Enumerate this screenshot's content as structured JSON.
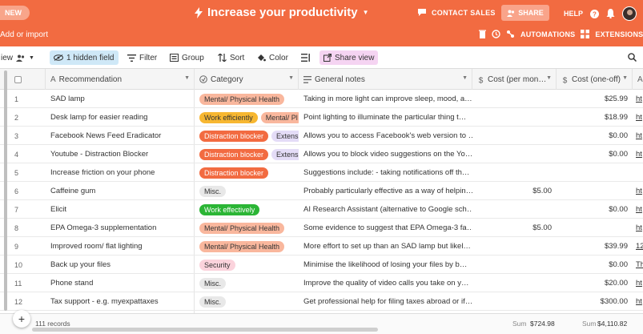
{
  "topbar": {
    "new_label": "NEW",
    "title": "Increase your productivity",
    "contact_label": "CONTACT SALES",
    "share_label": "SHARE",
    "help_label": "HELP",
    "add_import_label": "Add or import",
    "automations_label": "AUTOMATIONS",
    "extensions_label": "EXTENSIONS",
    "accent_color": "#f26b41"
  },
  "toolbar": {
    "view_label": "iew",
    "hidden_label": "1 hidden field",
    "filter_label": "Filter",
    "group_label": "Group",
    "sort_label": "Sort",
    "color_label": "Color",
    "share_view_label": "Share view"
  },
  "columns": {
    "recommendation": "Recommendation",
    "category": "Category",
    "notes": "General notes",
    "cost_per": "Cost (per mon…",
    "cost_one": "Cost (one-off)"
  },
  "rows": [
    {
      "num": "1",
      "rec": "SAD lamp",
      "tags": [
        {
          "label": "Mental/ Physical Health",
          "color": "#f9b79d"
        }
      ],
      "notes": "Taking in more light can improve sleep, mood, a…",
      "per": "",
      "one": "$25.99",
      "link": "ht"
    },
    {
      "num": "2",
      "rec": "Desk lamp for easier reading",
      "tags": [
        {
          "label": "Work efficiently",
          "color": "#f7b731"
        },
        {
          "label": "Mental/ Pl",
          "color": "#f9b79d"
        }
      ],
      "notes": "Point lighting to illuminate the particular thing t…",
      "per": "",
      "one": "$18.99",
      "link": "ht"
    },
    {
      "num": "3",
      "rec": "Facebook News Feed Eradicator",
      "tags": [
        {
          "label": "Distraction blocker",
          "color": "#f26b41"
        },
        {
          "label": "Extensi",
          "color": "#e4dcf7"
        }
      ],
      "notes": "Allows you to access Facebook's web version to …",
      "per": "",
      "one": "$0.00",
      "link": "ht"
    },
    {
      "num": "4",
      "rec": "Youtube - Distraction Blocker",
      "tags": [
        {
          "label": "Distraction blocker",
          "color": "#f26b41"
        },
        {
          "label": "Extensi",
          "color": "#e4dcf7"
        }
      ],
      "notes": "Allows you to block video suggestions on the Yo…",
      "per": "",
      "one": "$0.00",
      "link": "ht"
    },
    {
      "num": "5",
      "rec": "Increase friction on your phone",
      "tags": [
        {
          "label": "Distraction blocker",
          "color": "#f26b41"
        }
      ],
      "notes": "Suggestions include: - taking notifications off th…",
      "per": "",
      "one": "",
      "link": ""
    },
    {
      "num": "6",
      "rec": "Caffeine gum",
      "tags": [
        {
          "label": "Misc.",
          "color": "#e8e8e8"
        }
      ],
      "notes": "Probably particularly effective as a way of helpin…",
      "per": "$5.00",
      "one": "",
      "link": "ht"
    },
    {
      "num": "7",
      "rec": "Elicit",
      "tags": [
        {
          "label": "Work effectively",
          "color": "#2bb535"
        }
      ],
      "notes": "AI Research Assistant (alternative to Google sch…",
      "per": "",
      "one": "$0.00",
      "link": "ht"
    },
    {
      "num": "8",
      "rec": "EPA Omega-3 supplementation",
      "tags": [
        {
          "label": "Mental/ Physical Health",
          "color": "#f9b79d"
        }
      ],
      "notes": "Some evidence to suggest that EPA Omega-3 fa…",
      "per": "$5.00",
      "one": "",
      "link": "ht"
    },
    {
      "num": "9",
      "rec": "Improved room/ flat lighting",
      "tags": [
        {
          "label": "Mental/ Physical Health",
          "color": "#f9b79d"
        }
      ],
      "notes": "More effort to set up than an SAD lamp but likel…",
      "per": "",
      "one": "$39.99",
      "link": "12"
    },
    {
      "num": "10",
      "rec": "Back up your files",
      "tags": [
        {
          "label": "Security",
          "color": "#fbd3dc"
        }
      ],
      "notes": "Minimise the likelihood of losing your files by b…",
      "per": "",
      "one": "$0.00",
      "link": "Th"
    },
    {
      "num": "11",
      "rec": "Phone stand",
      "tags": [
        {
          "label": "Misc.",
          "color": "#e8e8e8"
        }
      ],
      "notes": "Improve the quality of video calls you take on y…",
      "per": "",
      "one": "$20.00",
      "link": "ht"
    },
    {
      "num": "12",
      "rec": "Tax support - e.g. myexpattaxes",
      "tags": [
        {
          "label": "Misc.",
          "color": "#e8e8e8"
        }
      ],
      "notes": "Get professional help for filing taxes abroad or if…",
      "per": "",
      "one": "$300.00",
      "link": "ht"
    }
  ],
  "footer": {
    "records": "111 records",
    "sum_per_label": "Sum",
    "sum_per": "$724.98",
    "sum_one_label": "Sum",
    "sum_one": "$4,110.82"
  }
}
